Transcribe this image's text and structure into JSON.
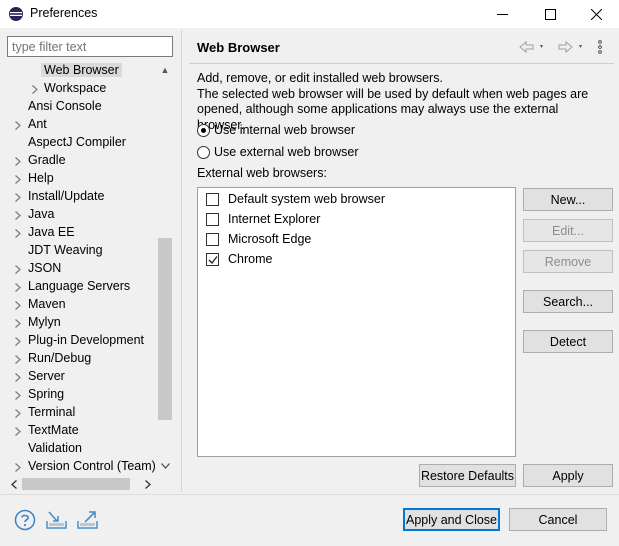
{
  "window": {
    "title": "Preferences",
    "minimize_label": "Minimize",
    "maximize_label": "Maximize",
    "close_label": "Close"
  },
  "sidebar": {
    "filter_placeholder": "type filter text",
    "items": [
      {
        "label": "Web Browser",
        "expandable": false,
        "indent": 2,
        "selected": true
      },
      {
        "label": "Workspace",
        "expandable": true,
        "indent": 2
      },
      {
        "label": "Ansi Console",
        "expandable": false,
        "indent": 1
      },
      {
        "label": "Ant",
        "expandable": true,
        "indent": 1
      },
      {
        "label": "AspectJ Compiler",
        "expandable": false,
        "indent": 1
      },
      {
        "label": "Gradle",
        "expandable": true,
        "indent": 1
      },
      {
        "label": "Help",
        "expandable": true,
        "indent": 1
      },
      {
        "label": "Install/Update",
        "expandable": true,
        "indent": 1
      },
      {
        "label": "Java",
        "expandable": true,
        "indent": 1
      },
      {
        "label": "Java EE",
        "expandable": true,
        "indent": 1
      },
      {
        "label": "JDT Weaving",
        "expandable": false,
        "indent": 1
      },
      {
        "label": "JSON",
        "expandable": true,
        "indent": 1
      },
      {
        "label": "Language Servers",
        "expandable": true,
        "indent": 1
      },
      {
        "label": "Maven",
        "expandable": true,
        "indent": 1
      },
      {
        "label": "Mylyn",
        "expandable": true,
        "indent": 1
      },
      {
        "label": "Plug-in Development",
        "expandable": true,
        "indent": 1
      },
      {
        "label": "Run/Debug",
        "expandable": true,
        "indent": 1
      },
      {
        "label": "Server",
        "expandable": true,
        "indent": 1
      },
      {
        "label": "Spring",
        "expandable": true,
        "indent": 1
      },
      {
        "label": "Terminal",
        "expandable": true,
        "indent": 1
      },
      {
        "label": "TextMate",
        "expandable": true,
        "indent": 1
      },
      {
        "label": "Validation",
        "expandable": false,
        "indent": 1
      },
      {
        "label": "Version Control (Team)",
        "expandable": true,
        "indent": 1
      }
    ]
  },
  "page": {
    "title": "Web Browser",
    "description": "Add, remove, or edit installed web browsers.\nThe selected web browser will be used by default when web pages are opened, although some applications may always use the external browser.",
    "radio_internal": "Use internal web browser",
    "radio_external": "Use external web browser",
    "selected_mode": "internal",
    "list_label": "External web browsers:",
    "browsers": [
      {
        "name": "Default system web browser",
        "checked": false
      },
      {
        "name": "Internet Explorer",
        "checked": false
      },
      {
        "name": "Microsoft Edge",
        "checked": false
      },
      {
        "name": "Chrome",
        "checked": true
      }
    ],
    "buttons": {
      "new": "New...",
      "edit": "Edit...",
      "remove": "Remove",
      "search": "Search...",
      "detect": "Detect"
    },
    "restore_defaults": "Restore Defaults",
    "apply": "Apply"
  },
  "footer": {
    "apply_and_close": "Apply and Close",
    "cancel": "Cancel"
  },
  "colors": {
    "accent": "#0078d7",
    "help_icon": "#3c84c4",
    "io_icon": "#4a90c8"
  }
}
